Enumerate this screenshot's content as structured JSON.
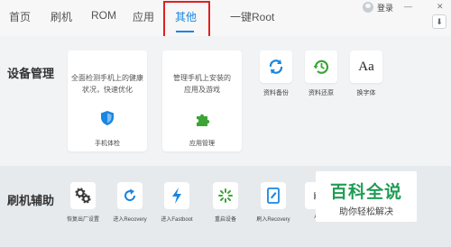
{
  "nav": {
    "tabs": [
      "首页",
      "刷机",
      "ROM",
      "应用",
      "其他",
      "一键Root"
    ],
    "active_tab": "其他",
    "login_label": "登录",
    "minimize": "—",
    "close": "✕",
    "download_icon": "download-icon"
  },
  "device_management": {
    "title": "设备管理",
    "cards": [
      {
        "desc_line1": "全面检测手机上的健康",
        "desc_line2": "状况，快速优化",
        "label": "手机体检",
        "icon": "shield-icon"
      },
      {
        "desc_line1": "管理手机上安装的",
        "desc_line2": "应用及游戏",
        "label": "应用管理",
        "icon": "puzzle-icon"
      }
    ],
    "small_items": [
      {
        "label": "资料备份",
        "icon": "refresh-icon"
      },
      {
        "label": "资料还原",
        "icon": "restore-clock-icon"
      },
      {
        "label": "换字体",
        "icon": "font-icon",
        "glyph": "Aa"
      }
    ]
  },
  "flash_tools": {
    "title": "刷机辅助",
    "items": [
      {
        "label": "恢复出厂设置",
        "icon": "gears-icon"
      },
      {
        "label": "进入Recovery",
        "icon": "rotate-arrow-icon"
      },
      {
        "label": "进入Fastboot",
        "icon": "lightning-icon"
      },
      {
        "label": "重启设备",
        "icon": "spinner-icon"
      },
      {
        "label": "刷入Recovery",
        "icon": "tablet-icon"
      },
      {
        "label": "Ad",
        "icon": "adb-icon"
      }
    ]
  },
  "watermark": {
    "title": "百科全说",
    "subtitle": "助你轻松解决"
  },
  "colors": {
    "accent": "#1a86e0",
    "highlight": "#e02020",
    "green": "#3aa535"
  }
}
